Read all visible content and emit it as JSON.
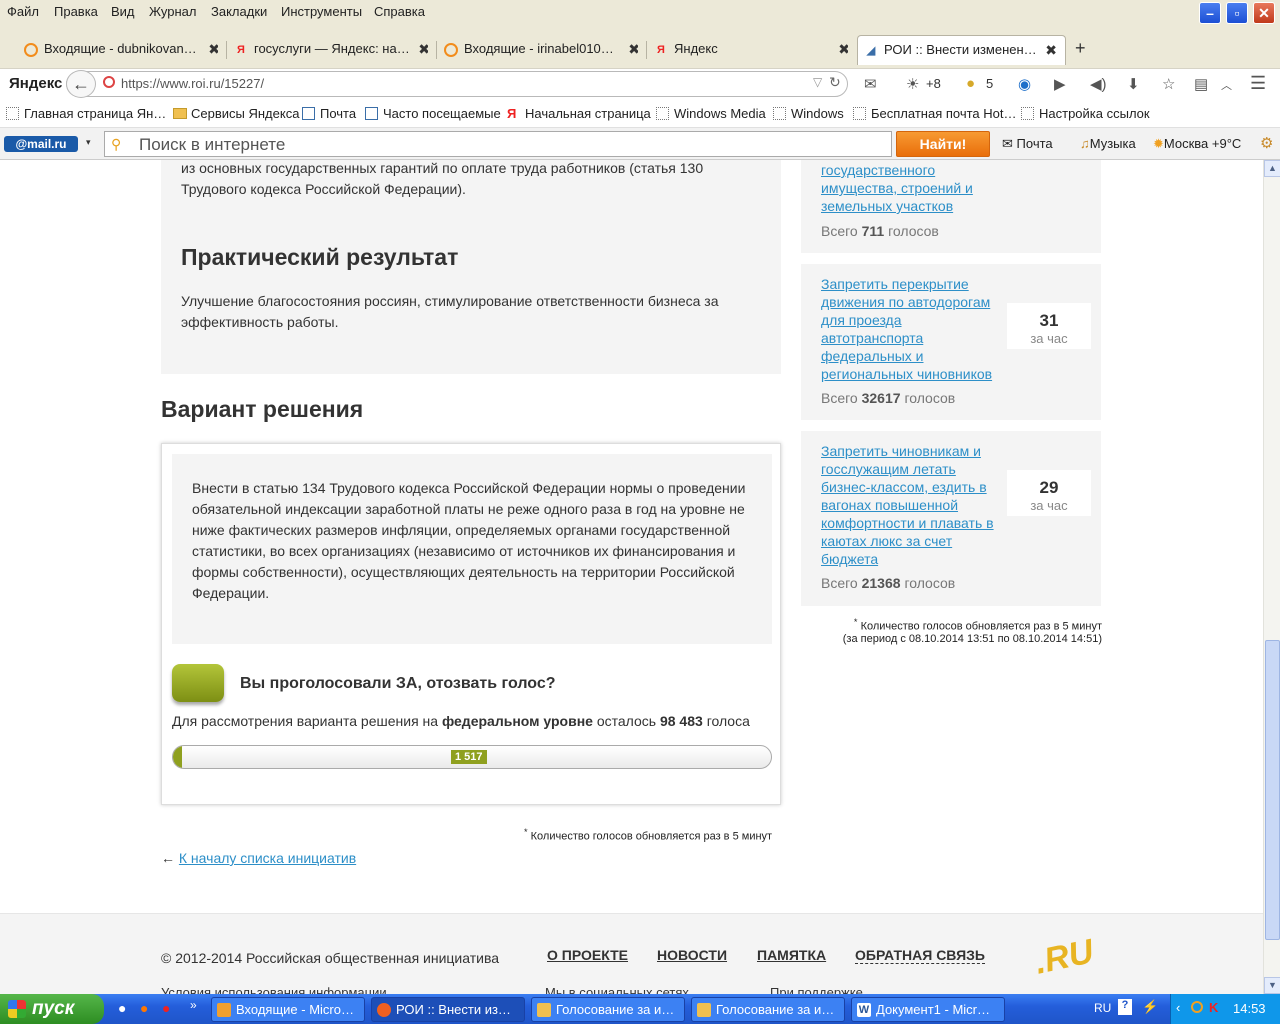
{
  "menu": [
    "Файл",
    "Правка",
    "Вид",
    "Журнал",
    "Закладки",
    "Инструменты",
    "Справка"
  ],
  "tabs": [
    {
      "label": "Входящие - dubnikovan…"
    },
    {
      "label": "госуслуги — Яндекс: на…"
    },
    {
      "label": "Входящие - irinabel010…"
    },
    {
      "label": "Яндекс"
    },
    {
      "label": "РОИ :: Внести изменен…"
    }
  ],
  "nav": {
    "url": "https://www.roi.ru/15227/",
    "logo": "Яндекс",
    "weather": "+8",
    "badge": "5"
  },
  "bookmarks": [
    "Главная страница Ян…",
    "Сервисы Яндекса",
    "Почта",
    "Часто посещаемые",
    "Начальная страница",
    "Windows Media",
    "Windows",
    "Бесплатная почта Hot…",
    "Настройка ссылок"
  ],
  "mailbar": {
    "logo": "@mail.ru",
    "search_placeholder": "Поиск в интернете",
    "search_button": "Найти!",
    "mail": "Почта",
    "music": "Музыка",
    "weather": "Москва +9°C"
  },
  "main": {
    "intro_text": "из основных государственных гарантий по оплате труда работников (статья 130 Трудового кодекса Российской Федерации).",
    "result_heading": "Практический результат",
    "result_text": "Улучшение благосостояния россиян, стимулирование ответственности бизнеса за эффективность работы.",
    "variant_heading": "Вариант решения",
    "variant_text": "Внести в статью 134 Трудового кодекса Российской Федерации нормы о проведении обязательной индексации заработной платы не реже одного раза в год на уровне не ниже фактических размеров инфляции, определяемых органами государственной статистики, во всех организациях (независимо от источников их финансирования и формы собственности), осуществляющих деятельность на территории Российской Федерации.",
    "vote_status": "Вы проголосовали ЗА, отозвать голос?",
    "remaining_prefix": "Для рассмотрения варианта решения на",
    "remaining_level": "федеральном уровне",
    "remaining_mid": "осталось",
    "remaining_count": "98 483",
    "remaining_suffix": "голоса",
    "progress_value": "1 517",
    "progress_fraction": 0.015,
    "note_star": "*",
    "note": "Количество голосов обновляется раз в 5 минут",
    "back_arrow": "←",
    "back_link": "К началу списка инициатив"
  },
  "sidebar": {
    "items": [
      {
        "title": "государственного имущества, строений и земельных участков",
        "total_label": "Всего",
        "total": "711",
        "total_suffix": "голосов"
      },
      {
        "title": "Запретить перекрытие движения по автодорогам для проезда автотранспорта федеральных и региональных чиновников",
        "count": "31",
        "count_label": "за час",
        "total_label": "Всего",
        "total": "32617",
        "total_suffix": "голосов"
      },
      {
        "title": "Запретить чиновникам и госслужащим летать бизнес-классом, ездить в вагонах повышенной комфортности и плавать в каютах люкс за счет бюджета",
        "count": "29",
        "count_label": "за час",
        "total_label": "Всего",
        "total": "21368",
        "total_suffix": "голосов"
      }
    ],
    "note_line1": "Количество голосов обновляется раз в 5 минут",
    "note_line2": "(за период с 08.10.2014 13:51 по 08.10.2014 14:51)"
  },
  "footer": {
    "copyright": "© 2012-2014 Российская общественная инициатива",
    "links": [
      "О ПРОЕКТЕ",
      "НОВОСТИ",
      "ПАМЯТКА",
      "ОБРАТНАЯ СВЯЗЬ"
    ],
    "sub1": "Условия использования информации",
    "sub2": "Мы в социальных сетях",
    "sub3": "При поддержке",
    "logo": ".RU"
  },
  "taskbar": {
    "start": "пуск",
    "buttons": [
      "Входящие - Micro…",
      "РОИ :: Внести из…",
      "Голосование за и…",
      "Голосование за и…",
      "Документ1 - Micr…"
    ],
    "lang": "RU",
    "clock": "14:53"
  },
  "colors": {
    "accent_green": "#8fa01f",
    "link": "#2d8fc8",
    "search_btn": "#f08424"
  }
}
